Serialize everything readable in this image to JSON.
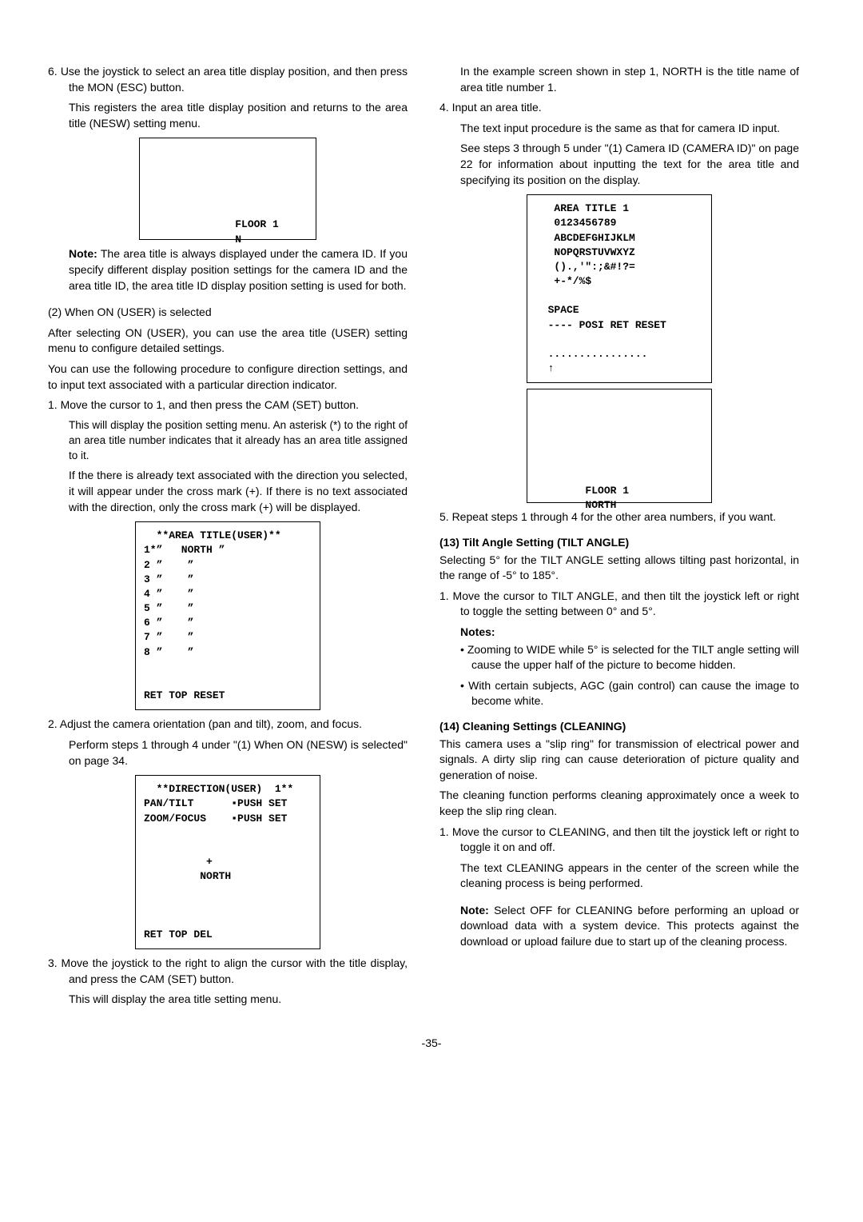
{
  "left": {
    "step6a": "6. Use the joystick to select an area title display position, and then press the MON (ESC) button.",
    "step6b": "This registers the area title display position and returns to the area title (NESW) setting menu.",
    "screen1": "\n\n\n\n\n              FLOOR 1\n              N",
    "noteLabel": "Note:",
    "noteText": " The area title is always displayed under the camera ID. If you specify different display position settings for the camera ID and the area title ID, the area title ID display position setting is used for both.",
    "onUserHeading": "(2) When ON (USER) is selected",
    "onUserP1": "After selecting ON (USER), you can use the area title (USER) setting menu to configure detailed settings.",
    "onUserP2": "You can use the following procedure to configure direction settings, and to input text associated with a particular direction indicator.",
    "step1a": "1. Move the cursor to 1, and then press the CAM (SET) button.",
    "step1b": "This will display the position setting menu. An asterisk (*) to the right of an area title number indicates that it already has an area title assigned to it.",
    "step1c": "If the there is already text associated with the direction you selected, it will appear under the cross mark (+). If there is no text associated with the direction, only the cross mark (+) will be displayed.",
    "screen2": "  **AREA TITLE(USER)**\n1*”   NORTH ”\n2 ”    ”\n3 ”    ”\n4 ”    ”\n5 ”    ”\n6 ”    ”\n7 ”    ”\n8 ”    ”\n\n\nRET TOP RESET",
    "step2a": "2. Adjust the camera orientation (pan and tilt), zoom, and focus.",
    "step2b": "Perform steps 1 through 4 under \"(1) When ON (NESW) is selected\" on page 34.",
    "screen3": "  **DIRECTION(USER)  1**\nPAN/TILT      ▪PUSH SET\nZOOM/FOCUS    ▪PUSH SET\n\n\n          +\n         NORTH\n\n\n\nRET TOP DEL",
    "step3a": "3. Move the joystick to the right to align the cursor with the title display, and press the CAM (SET) button.",
    "step3b": "This will display the area title setting menu."
  },
  "right": {
    "topA": "In the example screen shown in step 1, NORTH is the title name of area title number 1.",
    "step4a": "4. Input an area title.",
    "step4b": "The text input procedure is the same as that for camera ID input.",
    "step4c": "See steps 3 through 5 under \"(1) Camera ID (CAMERA ID)\" on page 22 for information about inputting the text for the area title and specifying its position on the display.",
    "screen4": "   AREA TITLE 1\n   0123456789\n   ABCDEFGHIJKLM\n   NOPQRSTUVWXYZ\n   ().,'\":;&#!?=\n   +-*/%$\n\n  SPACE\n  ---- POSI RET RESET\n\n  ................\n  ↑",
    "screen5": "\n\n\n\n\n\n        FLOOR 1\n        NORTH",
    "step5": "5. Repeat steps 1 through 4 for the other area numbers, if you want.",
    "h13": "(13) Tilt Angle Setting (TILT ANGLE)",
    "p13a": "Selecting 5° for the TILT ANGLE setting allows tilting past horizontal, in the range of -5° to 185°.",
    "p13b": "1. Move the cursor to TILT ANGLE, and then tilt the joystick left or right to toggle the setting between 0° and 5°.",
    "notesLabel": "Notes:",
    "note1": "Zooming to WIDE while 5° is selected for the TILT angle setting will cause the upper half of the picture to become hidden.",
    "note2": "With certain subjects, AGC (gain control) can cause the image to become white.",
    "h14": "(14) Cleaning Settings (CLEANING)",
    "p14a": "This camera uses a \"slip ring\" for transmission of electrical power and signals. A dirty slip ring can cause deterioration of picture quality and generation of noise.",
    "p14b": "The cleaning function performs cleaning approximately once a week to keep the slip ring clean.",
    "p14c": "1. Move the cursor to CLEANING, and then tilt the joystick left or right to toggle it on and off.",
    "p14d": "The text CLEANING appears in the center of the screen while the cleaning process is being performed.",
    "note14Label": "Note:",
    "note14": " Select OFF for CLEANING before performing an upload or download data with a system device. This protects against the download or upload failure due to start up of the cleaning process."
  },
  "pagenum": "-35-"
}
